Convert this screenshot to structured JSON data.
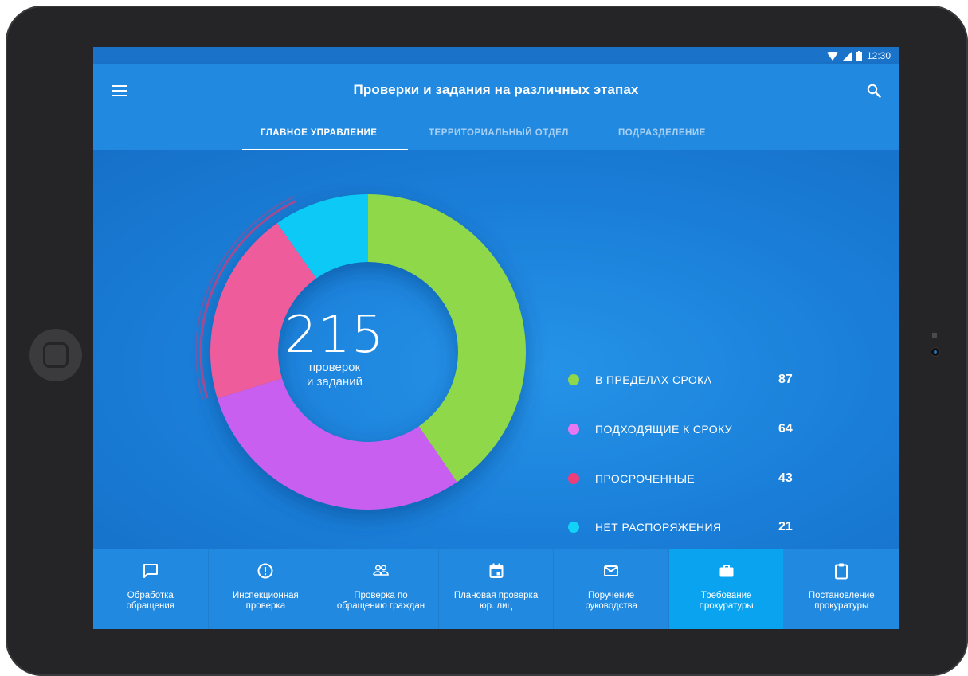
{
  "statusbar": {
    "time": "12:30"
  },
  "appbar": {
    "title": "Проверки и задания на различных этапах",
    "menu_icon": "menu-icon",
    "search_icon": "search-icon"
  },
  "tabs": [
    {
      "label": "ГЛАВНОЕ УПРАВЛЕНИЕ",
      "active": true
    },
    {
      "label": "ТЕРРИТОРИАЛЬНЫЙ ОТДЕЛ",
      "active": false
    },
    {
      "label": "ПОДРАЗДЕЛЕНИЕ",
      "active": false
    }
  ],
  "summary": {
    "total": "215",
    "label_line1": "проверок",
    "label_line2": "и заданий"
  },
  "chart_data": {
    "type": "pie",
    "categories": [
      "В ПРЕДЕЛАХ СРОКА",
      "ПОДХОДЯЩИЕ К СРОКУ",
      "ПРОСРОЧЕННЫЕ",
      "НЕТ РАСПОРЯЖЕНИЯ"
    ],
    "values": [
      87,
      64,
      43,
      21
    ],
    "colors": [
      "#8fd84a",
      "#c85ff0",
      "#ee5c9c",
      "#0ccaf5"
    ],
    "donut": true,
    "total": 215
  },
  "legend": [
    {
      "label": "В ПРЕДЕЛАХ СРОКА",
      "value": "87",
      "color": "#8fd84a"
    },
    {
      "label": "ПОДХОДЯЩИЕ К СРОКУ",
      "value": "64",
      "color": "#e778f2"
    },
    {
      "label": "ПРОСРОЧЕННЫЕ",
      "value": "43",
      "color": "#ee3e7a"
    },
    {
      "label": "НЕТ РАСПОРЯЖЕНИЯ",
      "value": "21",
      "color": "#12d2f8"
    }
  ],
  "bottomnav": [
    {
      "label": "Обработка\nобращения",
      "icon": "chat-bubble-icon",
      "active": false
    },
    {
      "label": "Инспекционная\nпроверка",
      "icon": "alert-circle-icon",
      "active": false
    },
    {
      "label": "Проверка по\nобращению граждан",
      "icon": "people-icon",
      "active": false
    },
    {
      "label": "Плановая проверка\nюр. лиц",
      "icon": "calendar-icon",
      "active": false
    },
    {
      "label": "Поручение\nруководства",
      "icon": "mail-icon",
      "active": false
    },
    {
      "label": "Требование\nпрокуратуры",
      "icon": "briefcase-icon",
      "active": true
    },
    {
      "label": "Постановление\nпрокуратуры",
      "icon": "clipboard-icon",
      "active": false
    }
  ]
}
